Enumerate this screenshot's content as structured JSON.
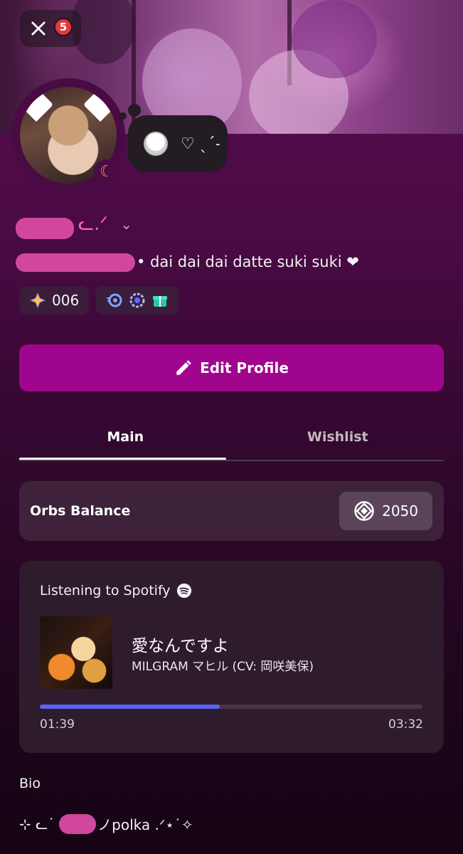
{
  "header": {
    "close_icon": "close-icon",
    "notification_count": "5"
  },
  "profile": {
    "name_suffix": "ᓚ.ᐟ",
    "tagline": "• dai dai dai datte suki suki ❤",
    "status_text": "♡ ˎˊ˗",
    "status_moon": "moon-icon",
    "badge_count_pill": "006",
    "badge_icons": [
      "nitro-icon",
      "laurel-icon",
      "gift-icon"
    ]
  },
  "actions": {
    "edit_profile_label": "Edit Profile"
  },
  "tabs": [
    {
      "label": "Main",
      "active": true
    },
    {
      "label": "Wishlist",
      "active": false
    }
  ],
  "orbs": {
    "label": "Orbs Balance",
    "value": "2050"
  },
  "spotify": {
    "header": "Listening to Spotify",
    "song_title": "愛なんですよ",
    "artist": "MILGRAM マヒル (CV: 岡咲美保)",
    "elapsed": "01:39",
    "duration": "03:32",
    "progress": 0.47
  },
  "bio": {
    "label": "Bio",
    "text_prefix": "⊹ ᓚ˙",
    "text_suffix": "ノpolka .ᐟ⋆˙✧"
  },
  "colors": {
    "accent": "#a0068d",
    "progress": "#5865f2",
    "redacted": "#d2479e"
  }
}
